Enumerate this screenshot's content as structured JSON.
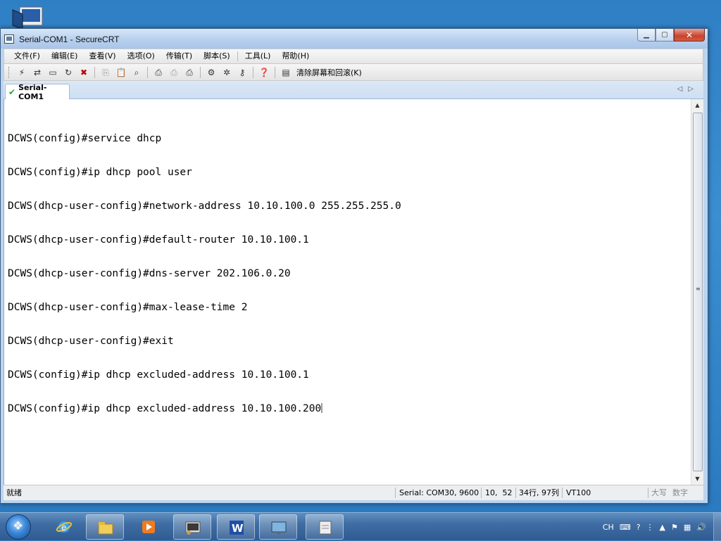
{
  "window": {
    "title": "Serial-COM1 - SecureCRT",
    "minimize_icon": "minimize-icon",
    "maximize_icon": "maximize-icon",
    "close_icon": "close-icon"
  },
  "menubar": {
    "items": [
      "文件(F)",
      "编辑(E)",
      "查看(V)",
      "选项(O)",
      "传输(T)",
      "脚本(S)",
      "工具(L)",
      "帮助(H)"
    ]
  },
  "toolbar": {
    "icons": [
      "connect-icon",
      "quick-connect-icon",
      "connect-tab-icon",
      "reconnect-icon",
      "disconnect-icon",
      "copy-icon",
      "paste-icon",
      "find-icon",
      "print-icon",
      "print-setup-icon",
      "print-screen-icon",
      "session-options-icon",
      "global-options-icon",
      "keymap-icon",
      "help-icon",
      "clear-screen-icon"
    ],
    "clear_label": "清除屏幕和回滚(K)"
  },
  "tabs": [
    {
      "label": "Serial-COM1",
      "active": true
    }
  ],
  "terminal": {
    "lines": [
      "DCWS(config)#service dhcp",
      "DCWS(config)#ip dhcp pool user",
      "DCWS(dhcp-user-config)#network-address 10.10.100.0 255.255.255.0",
      "DCWS(dhcp-user-config)#default-router 10.10.100.1",
      "DCWS(dhcp-user-config)#dns-server 202.106.0.20",
      "DCWS(dhcp-user-config)#max-lease-time 2",
      "DCWS(dhcp-user-config)#exit",
      "DCWS(config)#ip dhcp excluded-address 10.10.100.1",
      "DCWS(config)#ip dhcp excluded-address 10.10.100.200"
    ]
  },
  "statusbar": {
    "status": "就绪",
    "connection": "Serial: COM30, 9600",
    "cursor_pos": "10,  52",
    "size": "34行, 97列",
    "emulation": "VT100",
    "caps": "大写",
    "num": "数字"
  },
  "taskbar": {
    "apps": [
      "internet-explorer-icon",
      "file-explorer-icon",
      "media-player-icon",
      "securecrt-icon",
      "word-icon",
      "remote-desktop-icon",
      "notepad-icon"
    ],
    "tray_lang": "CH"
  },
  "colors": {
    "desktop": "#2f7fc4",
    "close_button": "#c9432d",
    "tab_check": "#2fa12f"
  }
}
